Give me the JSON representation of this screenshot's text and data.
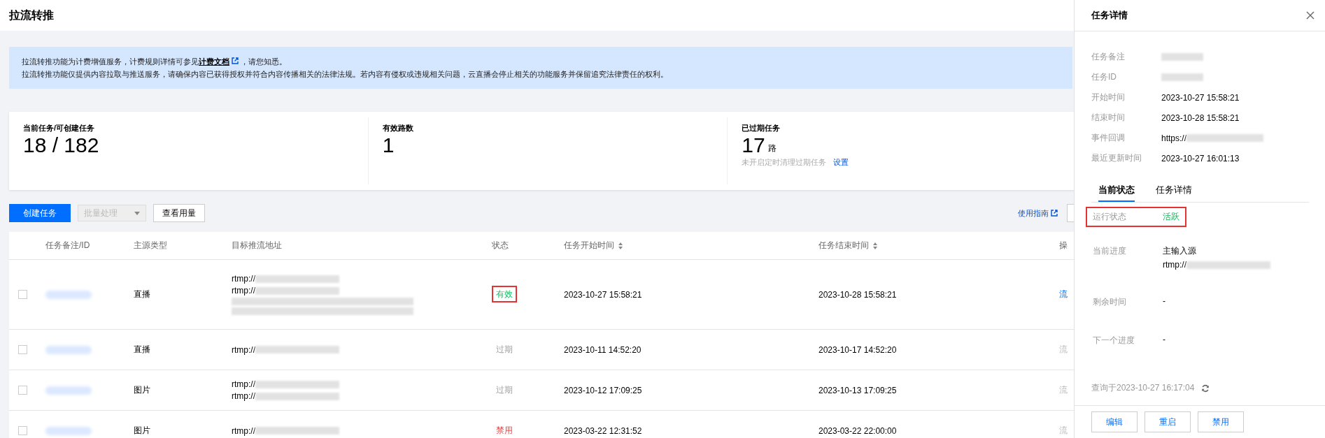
{
  "page": {
    "title": "拉流转推"
  },
  "notice": {
    "line1_before": "拉流转推功能为计费增值服务，计费规则详情可参见",
    "link": "计费文档",
    "line1_after": "，请您知悉。",
    "line2": "拉流转推功能仅提供内容拉取与推送服务，请确保内容已获得授权并符合内容传播相关的法律法规。若内容有侵权或违规相关问题，云直播会停止相关的功能服务并保留追究法律责任的权利。"
  },
  "stats": [
    {
      "label": "当前任务/可创建任务",
      "value": "18 / 182"
    },
    {
      "label": "有效路数",
      "value": "1"
    },
    {
      "label": "已过期任务",
      "value": "17",
      "unit": "路",
      "note": "未开启定时清理过期任务",
      "link": "设置"
    }
  ],
  "toolbar": {
    "create": "创建任务",
    "batch": {
      "label": "批量处理",
      "disabled": true
    },
    "usage": "查看用量",
    "guide": "使用指南"
  },
  "table": {
    "columns": [
      {
        "label": "任务备注/ID"
      },
      {
        "label": "主源类型"
      },
      {
        "label": "目标推流地址"
      },
      {
        "label": "状态"
      },
      {
        "label": "任务开始时间",
        "sortable": true
      },
      {
        "label": "任务结束时间",
        "sortable": true
      },
      {
        "label": "操"
      }
    ],
    "rows": [
      {
        "checked": false,
        "id_blurred": true,
        "type": "直播",
        "targets": [
          {
            "text": "rtmp://",
            "blurred": true
          },
          {
            "text": "rtmp://",
            "blurred": true
          },
          {
            "blurred": true
          },
          {
            "blurred": true
          }
        ],
        "status": "有效",
        "kind": "valid",
        "highlighted": true,
        "start": "2023-10-27 15:58:21",
        "end": "2023-10-28 15:58:21",
        "action": "流",
        "action_disabled": false
      },
      {
        "checked": false,
        "id_blurred": true,
        "type": "直播",
        "targets": [
          {
            "text": "rtmp://",
            "blurred": true
          }
        ],
        "status": "过期",
        "kind": "expired",
        "highlighted": false,
        "start": "2023-10-11 14:52:20",
        "end": "2023-10-17 14:52:20",
        "action": "流",
        "action_disabled": true
      },
      {
        "checked": false,
        "id_blurred": true,
        "type": "图片",
        "targets": [
          {
            "text": "rtmp://",
            "blurred": true
          },
          {
            "text": "rtmp://",
            "blurred": true
          }
        ],
        "status": "过期",
        "kind": "expired",
        "highlighted": false,
        "start": "2023-10-12 17:09:25",
        "end": "2023-10-13 17:09:25",
        "action": "流",
        "action_disabled": true
      },
      {
        "checked": false,
        "id_blurred": true,
        "type": "图片",
        "targets": [
          {
            "text": "rtmp://",
            "blurred": true
          }
        ],
        "status": "禁用",
        "kind": "disabled",
        "highlighted": false,
        "start": "2023-03-22 12:31:52",
        "end": "2023-03-22 22:00:00",
        "action": "流",
        "action_disabled": true
      }
    ]
  },
  "panel": {
    "title": "任务详情",
    "fields": [
      {
        "label": "任务备注",
        "blurred": true
      },
      {
        "label": "任务ID",
        "blurred": true
      },
      {
        "label": "开始时间",
        "value": "2023-10-27 15:58:21"
      },
      {
        "label": "结束时间",
        "value": "2023-10-28 15:58:21"
      },
      {
        "label": "事件回调",
        "value": "https://",
        "blurred": true
      },
      {
        "label": "最近更新时间",
        "value": "2023-10-27 16:01:13"
      }
    ],
    "tabs": [
      {
        "label": "当前状态",
        "selected": true
      },
      {
        "label": "任务详情",
        "selected": false
      }
    ],
    "status": [
      {
        "label": "运行状态",
        "value": "活跃",
        "kind": "active",
        "highlighted": true
      },
      {
        "label": "当前进度",
        "value": "主输入源",
        "sub": "rtmp://",
        "sub_blurred": true,
        "kind": "plain",
        "highlighted": false
      },
      {
        "label": "剩余时间",
        "value": "-",
        "kind": "plain",
        "highlighted": false
      },
      {
        "label": "下一个进度",
        "value": "-",
        "kind": "plain",
        "highlighted": false
      }
    ],
    "queried": "查询于2023-10-27 16:17:04",
    "buttons": [
      "编辑",
      "重启",
      "禁用"
    ]
  }
}
